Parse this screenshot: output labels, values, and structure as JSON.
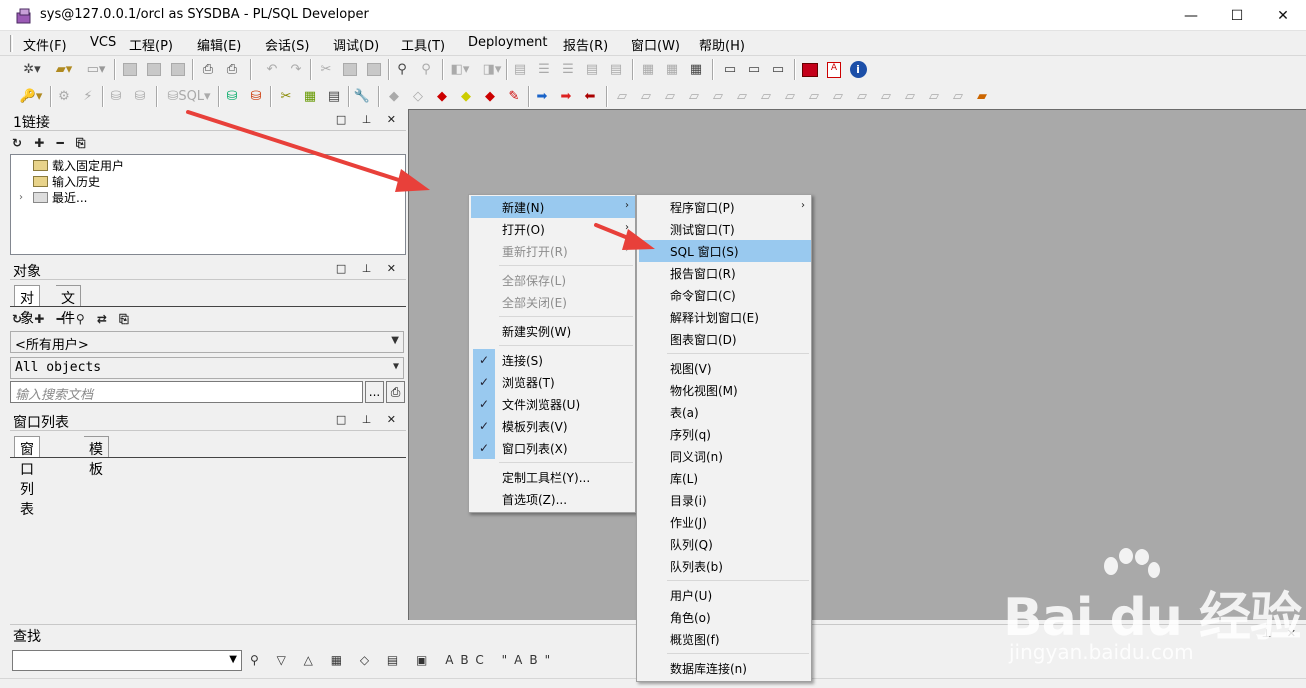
{
  "window": {
    "title": "sys@127.0.0.1/orcl as SYSDBA - PL/SQL Developer",
    "min": "—",
    "max": "☐",
    "close": "✕"
  },
  "menu": [
    {
      "name": "menu-file",
      "label": "文件(F)"
    },
    {
      "name": "menu-vcs",
      "label": "VCS"
    },
    {
      "name": "menu-project",
      "label": "工程(P)"
    },
    {
      "name": "menu-edit",
      "label": "编辑(E)"
    },
    {
      "name": "menu-session",
      "label": "会话(S)"
    },
    {
      "name": "menu-debug",
      "label": "调试(D)"
    },
    {
      "name": "menu-tools",
      "label": "工具(T)"
    },
    {
      "name": "menu-deployment",
      "label": "Deployment"
    },
    {
      "name": "menu-reports",
      "label": "报告(R)"
    },
    {
      "name": "menu-window",
      "label": "窗口(W)"
    },
    {
      "name": "menu-help",
      "label": "帮助(H)"
    }
  ],
  "connections_panel": {
    "title": "1链接",
    "controls": "□ ⊥ ✕",
    "tools": "↻ ✚ ━ ⎘",
    "tree": [
      "载入固定用户",
      "输入历史",
      "最近..."
    ]
  },
  "objects_panel": {
    "title": "对象",
    "controls": "□ ⊥ ✕",
    "tabs": [
      "对象",
      "文件"
    ],
    "tools": "↻ ✚ ━ ⚲ ⇄ ⎘",
    "user_filter": "<所有用户>",
    "object_filter": "All objects",
    "search_placeholder": "输入搜索文档",
    "search_btn": "...",
    "doc_btn": "⎙"
  },
  "windows_panel": {
    "title": "窗口列表",
    "controls": "□ ⊥ ✕",
    "tabs": [
      "窗口列表",
      "模板"
    ]
  },
  "find_panel": {
    "title": "查找",
    "controls": "⊥ ✕",
    "tools": "⚲ ▽ △ ▦ ◇ ▤ ▣ ABC \"AB\""
  },
  "context_menu": {
    "items": [
      {
        "label": "新建(N)",
        "highlighted": true,
        "submenu": true
      },
      {
        "label": "打开(O)",
        "submenu": true
      },
      {
        "label": "重新打开(R)",
        "disabled": true,
        "submenu": true
      },
      {
        "label": "全部保存(L)",
        "disabled": true
      },
      {
        "label": "全部关闭(E)",
        "disabled": true
      },
      {
        "label": "新建实例(W)"
      },
      {
        "label": "连接(S)",
        "checked": true
      },
      {
        "label": "浏览器(T)",
        "checked": true
      },
      {
        "label": "文件浏览器(U)",
        "checked": true
      },
      {
        "label": "模板列表(V)",
        "checked": true
      },
      {
        "label": "窗口列表(X)",
        "checked": true
      },
      {
        "label": "定制工具栏(Y)..."
      },
      {
        "label": "首选项(Z)..."
      }
    ]
  },
  "new_submenu": {
    "items": [
      {
        "label": "程序窗口(P)",
        "submenu": true
      },
      {
        "label": "测试窗口(T)"
      },
      {
        "label": "SQL 窗口(S)",
        "highlighted": true
      },
      {
        "label": "报告窗口(R)"
      },
      {
        "label": "命令窗口(C)"
      },
      {
        "label": "解释计划窗口(E)"
      },
      {
        "label": "图表窗口(D)"
      },
      {
        "label": "视图(V)"
      },
      {
        "label": "物化视图(M)"
      },
      {
        "label": "表(a)"
      },
      {
        "label": "序列(q)"
      },
      {
        "label": "同义词(n)"
      },
      {
        "label": "库(L)"
      },
      {
        "label": "目录(i)"
      },
      {
        "label": "作业(J)"
      },
      {
        "label": "队列(Q)"
      },
      {
        "label": "队列表(b)"
      },
      {
        "label": "用户(U)"
      },
      {
        "label": "角色(o)"
      },
      {
        "label": "概览图(f)"
      },
      {
        "label": "数据库连接(n)"
      }
    ]
  },
  "watermark": {
    "brand": "Bai du 经验",
    "url": "jingyan.baidu.com"
  },
  "colors": {
    "highlight": "#99c9ef",
    "arrow": "#e8403a",
    "workspace": "#a9a9a9"
  }
}
